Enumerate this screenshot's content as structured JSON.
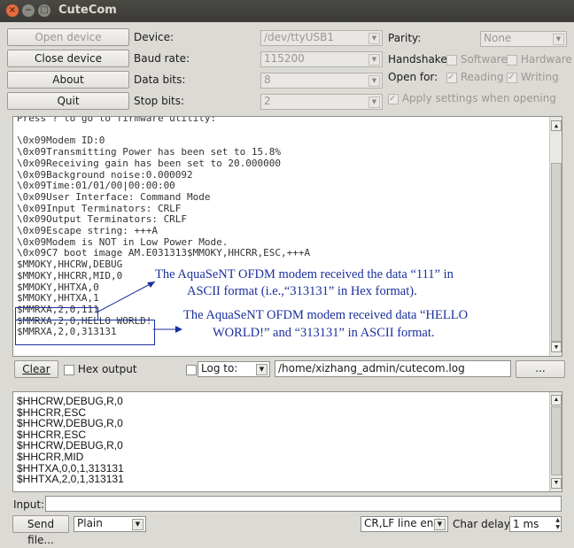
{
  "window": {
    "title": "CuteCom",
    "close_glyph": "×",
    "minimize_glyph": "−",
    "maximize_glyph": "□"
  },
  "left_buttons": {
    "open_device": "Open device",
    "close_device": "Close device",
    "about": "About",
    "quit": "Quit"
  },
  "settings": {
    "device_label": "Device:",
    "device_value": "/dev/ttyUSB1",
    "baud_label": "Baud rate:",
    "baud_value": "115200",
    "databits_label": "Data bits:",
    "databits_value": "8",
    "stopbits_label": "Stop bits:",
    "stopbits_value": "2",
    "parity_label": "Parity:",
    "parity_value": "None",
    "handshake_label": "Handshake:",
    "handshake_software": "Software",
    "handshake_hardware": "Hardware",
    "openfor_label": "Open for:",
    "openfor_reading": "Reading",
    "openfor_writing": "Writing",
    "apply_settings": "Apply settings when opening"
  },
  "output": {
    "lines": [
      "Press ? to go to firmware utility:",
      "",
      "\\0x09Modem ID:0",
      "\\0x09Transmitting Power has been set to 15.8%",
      "\\0x09Receiving gain has been set to 20.000000",
      "\\0x09Background noise:0.000092",
      "\\0x09Time:01/01/00|00:00:00",
      "\\0x09User Interface: Command Mode",
      "\\0x09Input Terminators: CRLF",
      "\\0x09Output Terminators: CRLF",
      "\\0x09Escape string: +++A",
      "\\0x09Modem is NOT in Low Power Mode.",
      "\\0x09C7 boot image AM.E031313$MMOKY,HHCRR,ESC,+++A",
      "$MMOKY,HHCRW,DEBUG",
      "$MMOKY,HHCRR,MID,0",
      "$MMOKY,HHTXA,0",
      "$MMOKY,HHTXA,1",
      "$MMRXA,2,0,111",
      "$MMRXA,2,0,HELLO WORLD!",
      "$MMRXA,2,0,313131"
    ],
    "annotation1_line1": "The AquaSeNT OFDM modem received the data “111” in",
    "annotation1_line2": "ASCII format (i.e.,“313131” in Hex format).",
    "annotation2_line1": "The AquaSeNT OFDM modem received data “HELLO",
    "annotation2_line2": "WORLD!” and “313131” in ASCII format."
  },
  "controls": {
    "clear": "Clear",
    "hex_output": "Hex output",
    "log_to_value": "Log to:",
    "log_path": "/home/xizhang_admin/cutecom.log",
    "browse": "..."
  },
  "history": {
    "lines": [
      "$HHCRW,DEBUG,R,0",
      "$HHCRR,ESC",
      "$HHCRW,DEBUG,R,0",
      "$HHCRR,ESC",
      "$HHCRW,DEBUG,R,0",
      "$HHCRR,MID",
      "$HHTXA,0,0,1,313131",
      "$HHTXA,2,0,1,313131"
    ]
  },
  "input": {
    "label": "Input:",
    "value": ""
  },
  "bottom": {
    "send_file": "Send file...",
    "format_value": "Plain",
    "line_end_value": "CR,LF line end",
    "char_delay_label": "Char delay:",
    "char_delay_value": "1 ms"
  },
  "icons": {
    "arrow_down": "▼",
    "arrow_up": "▲",
    "check": "✓"
  }
}
